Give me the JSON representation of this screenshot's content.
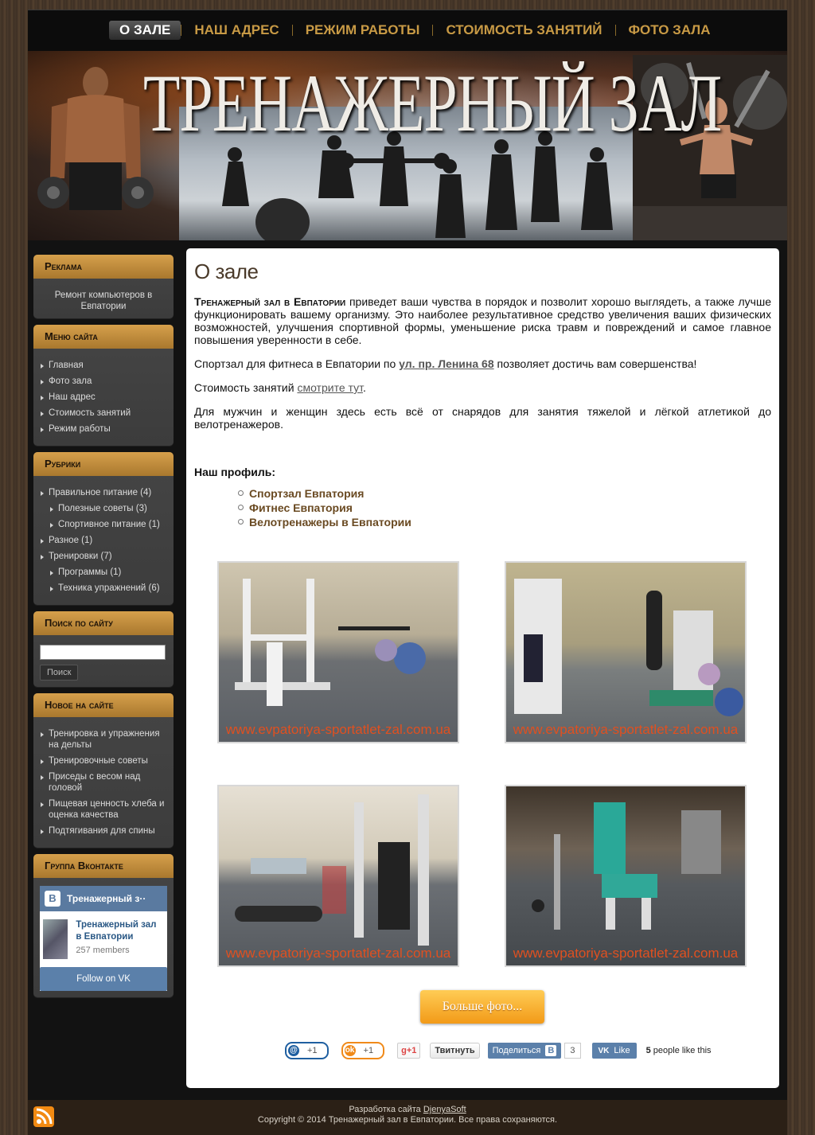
{
  "nav": {
    "items": [
      {
        "label": "О ЗАЛЕ",
        "active": true
      },
      {
        "label": "НАШ АДРЕС",
        "active": false
      },
      {
        "label": "РЕЖИМ РАБОТЫ",
        "active": false
      },
      {
        "label": "СТОИМОСТЬ ЗАНЯТИЙ",
        "active": false
      },
      {
        "label": "ФОТО ЗАЛА",
        "active": false
      }
    ]
  },
  "banner": {
    "title": "ТРЕНАЖЕРНЫЙ ЗАЛ"
  },
  "sidebar": {
    "ads": {
      "title": "Реклама",
      "text": "Ремонт компьютеров в Евпатории"
    },
    "menu": {
      "title": "Меню сайта",
      "items": [
        "Главная",
        "Фото зала",
        "Наш адрес",
        "Стоимость занятий",
        "Режим работы"
      ]
    },
    "rubrics": {
      "title": "Рубрики",
      "items": [
        {
          "label": "Правильное питание (4)",
          "sub": false
        },
        {
          "label": "Полезные советы (3)",
          "sub": true
        },
        {
          "label": "Спортивное питание (1)",
          "sub": true
        },
        {
          "label": "Разное (1)",
          "sub": false
        },
        {
          "label": "Тренировки (7)",
          "sub": false
        },
        {
          "label": "Программы (1)",
          "sub": true
        },
        {
          "label": "Техника упражнений (6)",
          "sub": true
        }
      ]
    },
    "search": {
      "title": "Поиск по сайту",
      "value": "",
      "button": "Поиск"
    },
    "news": {
      "title": "Новое на сайте",
      "items": [
        "Тренировка и упражнения на дельты",
        "Тренировочные советы",
        "Приседы с весом над головой",
        "Пищевая ценность хлеба и оценка качества",
        "Подтягивания для спины"
      ]
    },
    "vk": {
      "title": "Группа Вконтакте",
      "logo": "В",
      "header": "Тренажерный з··",
      "group_name": "Тренажерный зал в Евпатории",
      "members": "257 members",
      "follow": "Follow on VK"
    }
  },
  "main": {
    "title": "О зале",
    "p1_strong": "Тренажерный зал в Евпатории",
    "p1_rest": " приведет ваши чувства в порядок и позволит хорошо выглядеть, а также лучше функционировать  вашему организму. Это наиболее результативное средство увеличения ваших физических возможностей, улучшения спортивной формы, уменьшение риска травм и повреждений и самое главное повышения уверенности в себе.",
    "p2_pre": "Спортзал для фитнеса в Евпатории по ",
    "p2_link": "ул. пр. Ленина 68",
    "p2_post": " позволяет достичь вам совершенства!",
    "p3_pre": "Стоимость занятий ",
    "p3_link": "смотрите тут",
    "p3_post": ".",
    "p4": "Для мужчин и женщин здесь есть всё от снарядов для занятия тяжелой и лёгкой атлетикой до велотренажеров.",
    "profile_title": "Наш профиль:",
    "profile_items": [
      "Спортзал Евпатория",
      "Фитнес Евпатория",
      "Велотренажеры в Евпатории"
    ],
    "watermark": "www.evpatoriya-sportatlet-zal.com.ua",
    "more_button": "Больше фото...",
    "share": {
      "mail_count": "+1",
      "ok_count": "+1",
      "gplus": "g+1",
      "tweet": "Твитнуть",
      "vk_share": "Поделиться",
      "vk_b": "В",
      "vk_count": "3",
      "like": "Like",
      "like_count": "5",
      "like_text": " people like this"
    }
  },
  "footer": {
    "dev_pre": "Разработка сайта ",
    "dev_link": "DjenyaSoft",
    "copyright": "Copyright © 2014 Тренажерный зал в Евпатории. Все права сохраняются."
  }
}
